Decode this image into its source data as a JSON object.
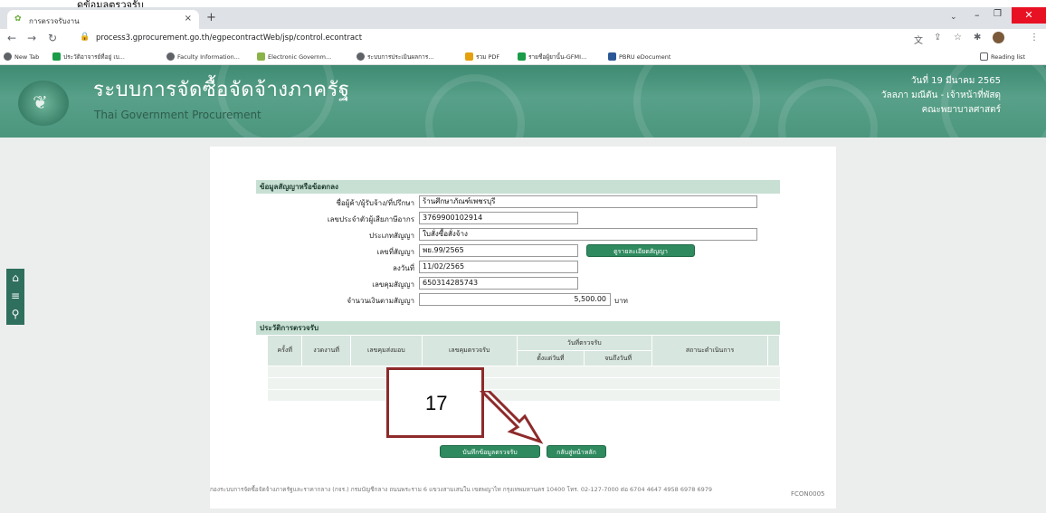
{
  "caption": "ดูข้อมูลตรวจรับ",
  "browser": {
    "tab_title": "การตรวจรับงาน",
    "tab_close": "×",
    "new_tab": "+",
    "url": "process3.gprocurement.go.th/egpecontractWeb/jsp/control.econtract",
    "reading_list": "Reading list",
    "bookmarks": [
      {
        "label": "New Tab",
        "color": "#5f6368"
      },
      {
        "label": "ประวัติอาจารย์ที่อยู่ เบ...",
        "color": "#1a9c48"
      },
      {
        "label": "Faculty Information...",
        "color": "#5f6368"
      },
      {
        "label": "Electronic Governm...",
        "color": "#8bb34a"
      },
      {
        "label": "ระบบการประเมินผลการ...",
        "color": "#5f6368"
      },
      {
        "label": "รวม PDF",
        "color": "#e5a00d"
      },
      {
        "label": "รายชื่อผู้ยานั้น-GFMI...",
        "color": "#1a9c48"
      },
      {
        "label": "PBRU eDocument",
        "color": "#2b5797"
      }
    ]
  },
  "header": {
    "title": "ระบบการจัดซื้อจัดจ้างภาครัฐ",
    "subtitle": "Thai Government Procurement",
    "date": "วันที่ 19 มีนาคม 2565",
    "user": "วัลลภา มณีตัน - เจ้าหน้าที่พัสดุ",
    "faculty": "คณะพยาบาลศาสตร์"
  },
  "contract": {
    "section_title": "ข้อมูลสัญญาหรือข้อตกลง",
    "vendor_label": "ชื่อผู้ค้า/ผู้รับจ้าง/ที่ปรึกษา",
    "vendor_value": "ร้านศึกษาภัณฑ์เพชรบุรี",
    "taxid_label": "เลขประจำตัวผู้เสียภาษีอากร",
    "taxid_value": "3769900102914",
    "type_label": "ประเภทสัญญา",
    "type_value": "ใบสั่งซื้อสั่งจ้าง",
    "number_label": "เลขที่สัญญา",
    "number_value": "พย.99/2565",
    "detail_button": "ดูรายละเอียดสัญญา",
    "date_label": "ลงวันที่",
    "date_value": "11/02/2565",
    "control_label": "เลขคุมสัญญา",
    "control_value": "650314285743",
    "amount_label": "จำนวนเงินตามสัญญา",
    "amount_value": "5,500.00",
    "amount_unit": "บาท"
  },
  "history": {
    "section_title": "ประวัติการตรวจรับ",
    "col_round": "ครั้งที่",
    "col_installment": "งวดงานที่",
    "col_delivery": "เลขคุมส่งมอบ",
    "col_inspection": "เลขคุมตรวจรับ",
    "col_inspect_date": "วันที่ตรวจรับ",
    "col_from": "ตั้งแต่วันที่",
    "col_to": "จนถึงวันที่",
    "col_status": "สถานะดำเนินการ"
  },
  "annotation": "17",
  "actions": {
    "save": "บันทึกข้อมูลตรวจรับ",
    "back": "กลับสู่หน้าหลัก"
  },
  "footer": {
    "text": "กองระบบการจัดซื้อจัดจ้างภาครัฐและราคากลาง (กจร.) กรมบัญชีกลาง ถนนพระราม 6 แขวงสามเสนใน เขตพญาไท กรุงเทพมหานคร 10400 โทร. 02-127-7000 ต่อ 6704 4647 4958 6978 6979",
    "code": "FCON0005"
  }
}
